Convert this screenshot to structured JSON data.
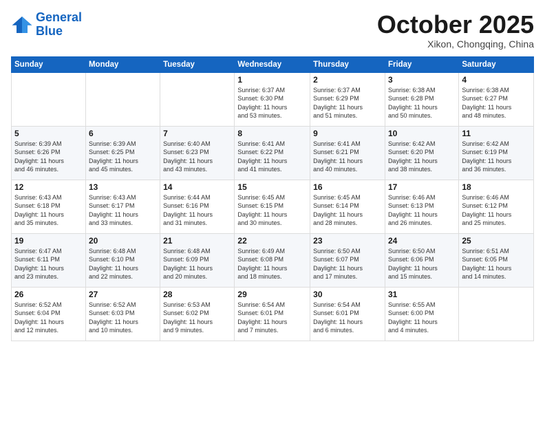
{
  "logo": {
    "line1": "General",
    "line2": "Blue"
  },
  "header": {
    "month": "October 2025",
    "location": "Xikon, Chongqing, China"
  },
  "weekdays": [
    "Sunday",
    "Monday",
    "Tuesday",
    "Wednesday",
    "Thursday",
    "Friday",
    "Saturday"
  ],
  "weeks": [
    [
      {
        "day": "",
        "info": ""
      },
      {
        "day": "",
        "info": ""
      },
      {
        "day": "",
        "info": ""
      },
      {
        "day": "1",
        "info": "Sunrise: 6:37 AM\nSunset: 6:30 PM\nDaylight: 11 hours\nand 53 minutes."
      },
      {
        "day": "2",
        "info": "Sunrise: 6:37 AM\nSunset: 6:29 PM\nDaylight: 11 hours\nand 51 minutes."
      },
      {
        "day": "3",
        "info": "Sunrise: 6:38 AM\nSunset: 6:28 PM\nDaylight: 11 hours\nand 50 minutes."
      },
      {
        "day": "4",
        "info": "Sunrise: 6:38 AM\nSunset: 6:27 PM\nDaylight: 11 hours\nand 48 minutes."
      }
    ],
    [
      {
        "day": "5",
        "info": "Sunrise: 6:39 AM\nSunset: 6:26 PM\nDaylight: 11 hours\nand 46 minutes."
      },
      {
        "day": "6",
        "info": "Sunrise: 6:39 AM\nSunset: 6:25 PM\nDaylight: 11 hours\nand 45 minutes."
      },
      {
        "day": "7",
        "info": "Sunrise: 6:40 AM\nSunset: 6:23 PM\nDaylight: 11 hours\nand 43 minutes."
      },
      {
        "day": "8",
        "info": "Sunrise: 6:41 AM\nSunset: 6:22 PM\nDaylight: 11 hours\nand 41 minutes."
      },
      {
        "day": "9",
        "info": "Sunrise: 6:41 AM\nSunset: 6:21 PM\nDaylight: 11 hours\nand 40 minutes."
      },
      {
        "day": "10",
        "info": "Sunrise: 6:42 AM\nSunset: 6:20 PM\nDaylight: 11 hours\nand 38 minutes."
      },
      {
        "day": "11",
        "info": "Sunrise: 6:42 AM\nSunset: 6:19 PM\nDaylight: 11 hours\nand 36 minutes."
      }
    ],
    [
      {
        "day": "12",
        "info": "Sunrise: 6:43 AM\nSunset: 6:18 PM\nDaylight: 11 hours\nand 35 minutes."
      },
      {
        "day": "13",
        "info": "Sunrise: 6:43 AM\nSunset: 6:17 PM\nDaylight: 11 hours\nand 33 minutes."
      },
      {
        "day": "14",
        "info": "Sunrise: 6:44 AM\nSunset: 6:16 PM\nDaylight: 11 hours\nand 31 minutes."
      },
      {
        "day": "15",
        "info": "Sunrise: 6:45 AM\nSunset: 6:15 PM\nDaylight: 11 hours\nand 30 minutes."
      },
      {
        "day": "16",
        "info": "Sunrise: 6:45 AM\nSunset: 6:14 PM\nDaylight: 11 hours\nand 28 minutes."
      },
      {
        "day": "17",
        "info": "Sunrise: 6:46 AM\nSunset: 6:13 PM\nDaylight: 11 hours\nand 26 minutes."
      },
      {
        "day": "18",
        "info": "Sunrise: 6:46 AM\nSunset: 6:12 PM\nDaylight: 11 hours\nand 25 minutes."
      }
    ],
    [
      {
        "day": "19",
        "info": "Sunrise: 6:47 AM\nSunset: 6:11 PM\nDaylight: 11 hours\nand 23 minutes."
      },
      {
        "day": "20",
        "info": "Sunrise: 6:48 AM\nSunset: 6:10 PM\nDaylight: 11 hours\nand 22 minutes."
      },
      {
        "day": "21",
        "info": "Sunrise: 6:48 AM\nSunset: 6:09 PM\nDaylight: 11 hours\nand 20 minutes."
      },
      {
        "day": "22",
        "info": "Sunrise: 6:49 AM\nSunset: 6:08 PM\nDaylight: 11 hours\nand 18 minutes."
      },
      {
        "day": "23",
        "info": "Sunrise: 6:50 AM\nSunset: 6:07 PM\nDaylight: 11 hours\nand 17 minutes."
      },
      {
        "day": "24",
        "info": "Sunrise: 6:50 AM\nSunset: 6:06 PM\nDaylight: 11 hours\nand 15 minutes."
      },
      {
        "day": "25",
        "info": "Sunrise: 6:51 AM\nSunset: 6:05 PM\nDaylight: 11 hours\nand 14 minutes."
      }
    ],
    [
      {
        "day": "26",
        "info": "Sunrise: 6:52 AM\nSunset: 6:04 PM\nDaylight: 11 hours\nand 12 minutes."
      },
      {
        "day": "27",
        "info": "Sunrise: 6:52 AM\nSunset: 6:03 PM\nDaylight: 11 hours\nand 10 minutes."
      },
      {
        "day": "28",
        "info": "Sunrise: 6:53 AM\nSunset: 6:02 PM\nDaylight: 11 hours\nand 9 minutes."
      },
      {
        "day": "29",
        "info": "Sunrise: 6:54 AM\nSunset: 6:01 PM\nDaylight: 11 hours\nand 7 minutes."
      },
      {
        "day": "30",
        "info": "Sunrise: 6:54 AM\nSunset: 6:01 PM\nDaylight: 11 hours\nand 6 minutes."
      },
      {
        "day": "31",
        "info": "Sunrise: 6:55 AM\nSunset: 6:00 PM\nDaylight: 11 hours\nand 4 minutes."
      },
      {
        "day": "",
        "info": ""
      }
    ]
  ]
}
